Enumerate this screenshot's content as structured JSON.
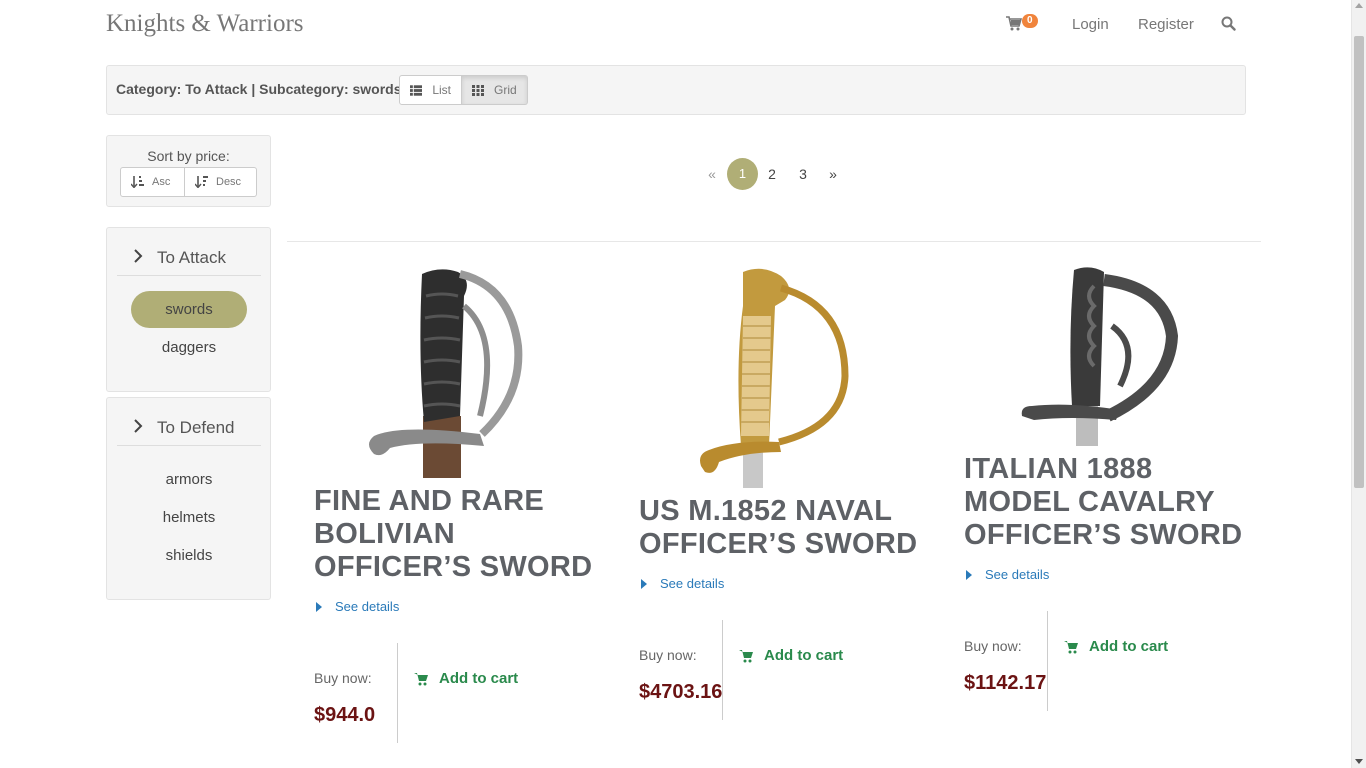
{
  "header": {
    "brand": "Knights & Warriors",
    "cart_count": "0",
    "login": "Login",
    "register": "Register"
  },
  "category_bar": {
    "text": "Category: To Attack | Subcategory: swords",
    "list_label": "List",
    "grid_label": "Grid",
    "active_view": "Grid"
  },
  "sort": {
    "title": "Sort by price:",
    "asc": "Asc",
    "desc": "Desc"
  },
  "categories": [
    {
      "label": "To Attack",
      "items": [
        {
          "label": "swords",
          "active": true
        },
        {
          "label": "daggers",
          "active": false
        }
      ]
    },
    {
      "label": "To Defend",
      "items": [
        {
          "label": "armors",
          "active": false
        },
        {
          "label": "helmets",
          "active": false
        },
        {
          "label": "shields",
          "active": false
        }
      ]
    }
  ],
  "pagination": {
    "prev": "«",
    "pages": [
      "1",
      "2",
      "3"
    ],
    "current": "1",
    "next": "»"
  },
  "products": [
    {
      "title": "FINE AND RARE BOLIVIAN OFFICER’S SWORD",
      "details": "See details",
      "buy_label": "Buy now:",
      "price": "$944.0",
      "add_to_cart": "Add to cart"
    },
    {
      "title": "US M.1852 NAVAL OFFICER’S SWORD",
      "details": "See details",
      "buy_label": "Buy now:",
      "price": "$4703.16",
      "add_to_cart": "Add to cart"
    },
    {
      "title": "ITALIAN 1888 MODEL CAVALRY OFFICER’S SWORD",
      "details": "See details",
      "buy_label": "Buy now:",
      "price": "$1142.17",
      "add_to_cart": "Add to cart"
    }
  ],
  "colors": {
    "accent": "#b0ae76",
    "price": "#6b1313",
    "cart_green": "#2a8a4c",
    "link_blue": "#2a7ab9",
    "badge": "#f0843c"
  },
  "icons": [
    "cart-icon",
    "search-icon",
    "list-icon",
    "grid-icon",
    "sort-asc-icon",
    "sort-desc-icon",
    "chevron-right-icon",
    "caret-right-icon",
    "shopping-cart-icon"
  ]
}
